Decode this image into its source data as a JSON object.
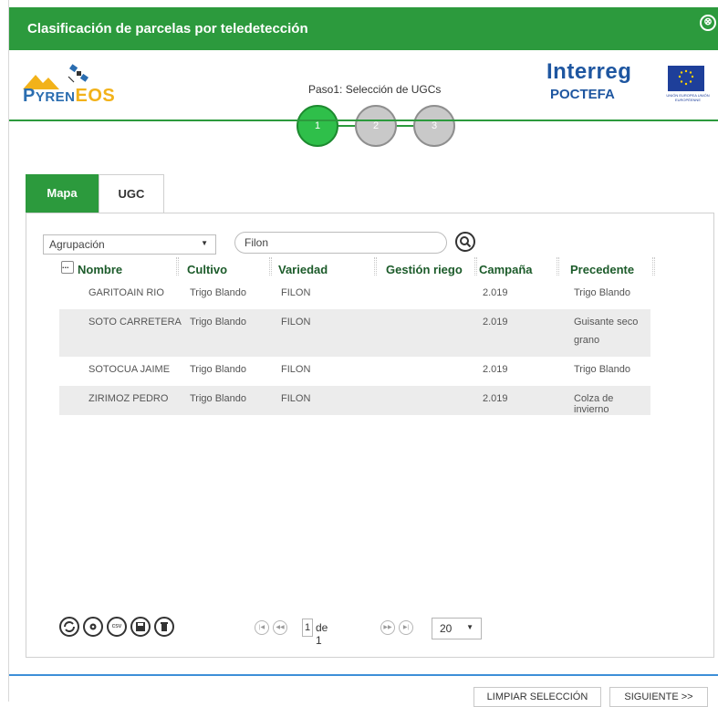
{
  "dialog": {
    "title": "Clasificación de parcelas por teledetección",
    "close_glyph": "⊗"
  },
  "header": {
    "logo_left": {
      "part1": "P",
      "part2": "YREN",
      "part3": "EOS"
    },
    "step_label": "Paso1: Selección de UGCs",
    "steps": [
      "1",
      "2",
      "3"
    ],
    "logo_right": {
      "line1": "Interreg",
      "line2": "POCTEFA",
      "eu_caption": "UNIÓN EUROPEA UNIÓN EUROPÉENNE"
    }
  },
  "tabs": [
    {
      "label": "Mapa"
    },
    {
      "label": "UGC"
    }
  ],
  "filters": {
    "grouping": {
      "value": "Agrupación"
    },
    "search": {
      "value": "Filon"
    }
  },
  "grid": {
    "select_all": "...",
    "columns": [
      "Nombre",
      "Cultivo",
      "Variedad",
      "Gestión riego",
      "Campaña",
      "Precedente"
    ],
    "rows": [
      {
        "nombre": "GARITOAIN RIO",
        "cultivo": "Trigo Blando",
        "variedad": "FILON",
        "gestion": "",
        "campana": "2.019",
        "precedente_1": "Trigo Blando",
        "precedente_2": ""
      },
      {
        "nombre": "SOTO CARRETERA",
        "cultivo": "Trigo Blando",
        "variedad": "FILON",
        "gestion": "",
        "campana": "2.019",
        "precedente_1": "Guisante seco",
        "precedente_2": "grano"
      },
      {
        "nombre": "SOTOCUA JAIME",
        "cultivo": "Trigo Blando",
        "variedad": "FILON",
        "gestion": "",
        "campana": "2.019",
        "precedente_1": "Trigo Blando",
        "precedente_2": ""
      },
      {
        "nombre": "ZIRIMOZ PEDRO",
        "cultivo": "Trigo Blando",
        "variedad": "FILON",
        "gestion": "",
        "campana": "2.019",
        "precedente_1": "Colza de invierno",
        "precedente_2": ""
      }
    ]
  },
  "toolbar": {
    "csv_label": "csv"
  },
  "pager": {
    "page": "1",
    "of_label": "de 1",
    "page_size": "20"
  },
  "footer": {
    "clear_label": "LIMPIAR SELECCIÓN",
    "next_label": "SIGUIENTE >>"
  },
  "colors": {
    "accent": "#2c9a3d",
    "active_step": "#2fbf4a",
    "inactive_step": "#c9c9c9",
    "footer_line": "#3d8fd8"
  }
}
